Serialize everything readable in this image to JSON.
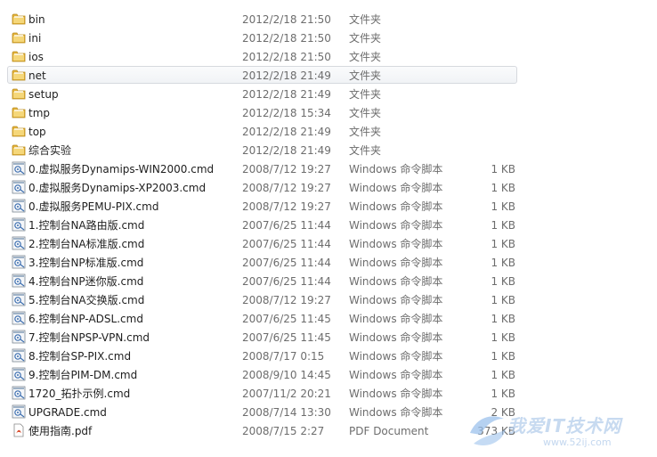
{
  "files": [
    {
      "name": "bin",
      "date": "2012/2/18 21:50",
      "type": "文件夹",
      "size": "",
      "icon": "folder-icon"
    },
    {
      "name": "ini",
      "date": "2012/2/18 21:50",
      "type": "文件夹",
      "size": "",
      "icon": "folder-icon"
    },
    {
      "name": "ios",
      "date": "2012/2/18 21:50",
      "type": "文件夹",
      "size": "",
      "icon": "folder-icon"
    },
    {
      "name": "net",
      "date": "2012/2/18 21:49",
      "type": "文件夹",
      "size": "",
      "icon": "folder-icon",
      "hover": true
    },
    {
      "name": "setup",
      "date": "2012/2/18 21:49",
      "type": "文件夹",
      "size": "",
      "icon": "folder-icon"
    },
    {
      "name": "tmp",
      "date": "2012/2/18 15:34",
      "type": "文件夹",
      "size": "",
      "icon": "folder-icon"
    },
    {
      "name": "top",
      "date": "2012/2/18 21:49",
      "type": "文件夹",
      "size": "",
      "icon": "folder-icon"
    },
    {
      "name": "综合实验",
      "date": "2012/2/18 21:49",
      "type": "文件夹",
      "size": "",
      "icon": "folder-icon"
    },
    {
      "name": "0.虚拟服务Dynamips-WIN2000.cmd",
      "date": "2008/7/12 19:27",
      "type": "Windows 命令脚本",
      "size": "1 KB",
      "icon": "cmd-script-icon"
    },
    {
      "name": "0.虚拟服务Dynamips-XP2003.cmd",
      "date": "2008/7/12 19:27",
      "type": "Windows 命令脚本",
      "size": "1 KB",
      "icon": "cmd-script-icon"
    },
    {
      "name": "0.虚拟服务PEMU-PIX.cmd",
      "date": "2008/7/12 19:27",
      "type": "Windows 命令脚本",
      "size": "1 KB",
      "icon": "cmd-script-icon"
    },
    {
      "name": "1.控制台NA路由版.cmd",
      "date": "2007/6/25 11:44",
      "type": "Windows 命令脚本",
      "size": "1 KB",
      "icon": "cmd-script-icon"
    },
    {
      "name": "2.控制台NA标准版.cmd",
      "date": "2007/6/25 11:44",
      "type": "Windows 命令脚本",
      "size": "1 KB",
      "icon": "cmd-script-icon"
    },
    {
      "name": "3.控制台NP标准版.cmd",
      "date": "2007/6/25 11:44",
      "type": "Windows 命令脚本",
      "size": "1 KB",
      "icon": "cmd-script-icon"
    },
    {
      "name": "4.控制台NP迷你版.cmd",
      "date": "2007/6/25 11:44",
      "type": "Windows 命令脚本",
      "size": "1 KB",
      "icon": "cmd-script-icon"
    },
    {
      "name": "5.控制台NA交换版.cmd",
      "date": "2008/7/12 19:27",
      "type": "Windows 命令脚本",
      "size": "1 KB",
      "icon": "cmd-script-icon"
    },
    {
      "name": "6.控制台NP-ADSL.cmd",
      "date": "2007/6/25 11:45",
      "type": "Windows 命令脚本",
      "size": "1 KB",
      "icon": "cmd-script-icon"
    },
    {
      "name": "7.控制台NPSP-VPN.cmd",
      "date": "2007/6/25 11:45",
      "type": "Windows 命令脚本",
      "size": "1 KB",
      "icon": "cmd-script-icon"
    },
    {
      "name": "8.控制台SP-PIX.cmd",
      "date": "2008/7/17 0:15",
      "type": "Windows 命令脚本",
      "size": "1 KB",
      "icon": "cmd-script-icon"
    },
    {
      "name": "9.控制台PIM-DM.cmd",
      "date": "2008/9/10 14:45",
      "type": "Windows 命令脚本",
      "size": "1 KB",
      "icon": "cmd-script-icon"
    },
    {
      "name": "1720_拓扑示例.cmd",
      "date": "2007/11/2 20:21",
      "type": "Windows 命令脚本",
      "size": "1 KB",
      "icon": "cmd-script-icon"
    },
    {
      "name": "UPGRADE.cmd",
      "date": "2008/7/14 13:30",
      "type": "Windows 命令脚本",
      "size": "2 KB",
      "icon": "cmd-script-icon"
    },
    {
      "name": "使用指南.pdf",
      "date": "2008/7/15 2:27",
      "type": "PDF Document",
      "size": "373 KB",
      "icon": "pdf-file-icon"
    }
  ],
  "watermark": {
    "text": "我爱IT技术网",
    "url": "www.52ij.com"
  }
}
